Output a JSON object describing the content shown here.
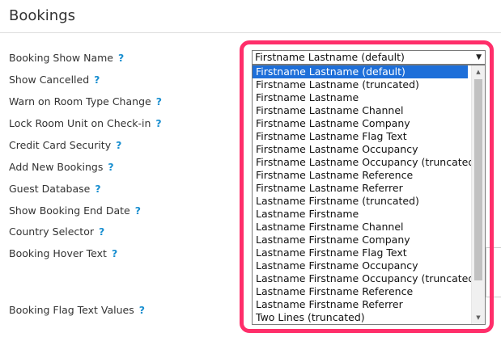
{
  "section": {
    "title": "Bookings"
  },
  "help_glyph": "?",
  "fields": [
    {
      "label": "Booking Show Name"
    },
    {
      "label": "Show Cancelled"
    },
    {
      "label": "Warn on Room Type Change"
    },
    {
      "label": "Lock Room Unit on Check-in"
    },
    {
      "label": "Credit Card Security"
    },
    {
      "label": "Add New Bookings"
    },
    {
      "label": "Guest Database"
    },
    {
      "label": "Show Booking End Date"
    },
    {
      "label": "Country Selector"
    },
    {
      "label": "Booking Hover Text"
    },
    {
      "label": "Booking Flag Text Values"
    }
  ],
  "booking_show_name_select": {
    "selected_value": "Firstname Lastname (default)",
    "arrow_icon": "chevron-down-icon",
    "options": [
      "Firstname Lastname (default)",
      "Firstname Lastname (truncated)",
      "Firstname Lastname",
      "Firstname Lastname Channel",
      "Firstname Lastname Company",
      "Firstname Lastname Flag Text",
      "Firstname Lastname Occupancy",
      "Firstname Lastname Occupancy (truncated)",
      "Firstname Lastname Reference",
      "Firstname Lastname Referrer",
      "Lastname Firstname (truncated)",
      "Lastname Firstname",
      "Lastname Firstname Channel",
      "Lastname Firstname Company",
      "Lastname Firstname Flag Text",
      "Lastname Firstname Occupancy",
      "Lastname Firstname Occupancy (truncated)",
      "Lastname Firstname Reference",
      "Lastname Firstname Referrer",
      "Two Lines (truncated)"
    ]
  },
  "colors": {
    "highlight": "#ff2e6a",
    "selected_option": "#1e6fd9",
    "help_icon": "#1a8fd0"
  }
}
